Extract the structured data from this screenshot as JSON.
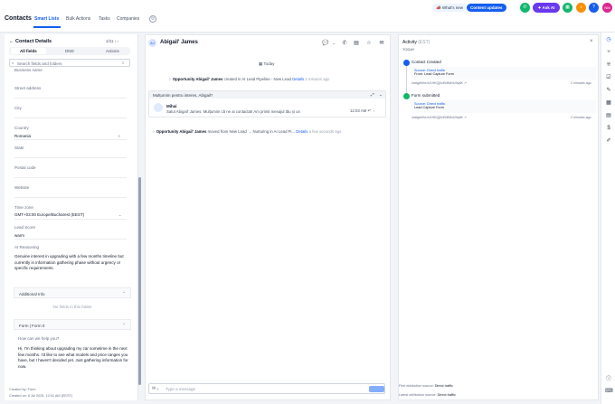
{
  "topbar": {
    "title": "Contacts",
    "tabs": [
      "Smart Lists",
      "Bulk Actions",
      "Tasks",
      "Companies"
    ],
    "whats_new": "What's new",
    "content_updates": "Content updates",
    "ask_ai": "Ask AI",
    "avatar": "NM",
    "help": "?"
  },
  "left": {
    "header": "Contact Details",
    "pager": "1/11",
    "tabs": [
      "All fields",
      "DND",
      "Actions"
    ],
    "search_placeholder": "Search fields and folders",
    "fields": [
      {
        "label": "Business name",
        "value": ""
      },
      {
        "label": "Street address",
        "value": ""
      },
      {
        "label": "City",
        "value": ""
      },
      {
        "label": "Country",
        "value": "Romania"
      },
      {
        "label": "State",
        "value": ""
      },
      {
        "label": "Postal code",
        "value": ""
      },
      {
        "label": "Website",
        "value": ""
      },
      {
        "label": "Time zone",
        "value": "GMT+03:00 Europe/Bucharest (EEST)"
      },
      {
        "label": "Lead Score",
        "value": "warm"
      },
      {
        "label": "AI Reasoning",
        "value": "Genuine interest in upgrading with a few months timeline but currently in information gathering phase without urgency or specific requirements."
      }
    ],
    "additional_info": "Additional Info",
    "no_fields": "No fields in this folder",
    "form_section": "Form | Form 0",
    "form_question": "How can we help you?",
    "form_answer": "Hi, I'm thinking about upgrading my car sometime in the next few months. I'd like to see what models and price ranges you have, but I haven't decided yet. Just gathering information for now.",
    "created_by": "Created by: Form",
    "created_at": "Created on: 6 Jul 2025, 12:01 AM (EEST)"
  },
  "center": {
    "avatar": "AJ",
    "name": "Abigail' James",
    "today": "Today",
    "event1_bold": "Opportunity Abigail' James",
    "event1_text": "created in AI Lead Pipeline - New Lead",
    "event1_link": "Details",
    "event1_time": "2 minutes ago",
    "chat_header": "Mulțumim pentru interes, Abigail'!",
    "chat_name": "Mihai",
    "chat_msg": "Salut Abigail' James. Mulțumim că ne ai contactat! Am primit mesajul tău și un",
    "chat_time": "12:03 AM",
    "event2_bold": "Opportunity Abigail' James",
    "event2_text": "moved from New Lead → Nurturing in AI Lead Pi...",
    "event2_link": "Details",
    "event2_time": "a few seconds ago",
    "composer_placeholder": "Type a message"
  },
  "right": {
    "title": "Activity",
    "title_tz": "(EST)",
    "today": "TODAY",
    "events": [
      {
        "title": "Contact Created",
        "source": "Source: Direct traffic",
        "detail": "From: Lead Capture Form",
        "url": "/widget/form/1HKQj0zEMlMvU9qdK",
        "time": "2 minutes ago",
        "color": "#155eef"
      },
      {
        "title": "Form submitted",
        "source": "Source: Direct traffic",
        "detail": "Lead Capture Form",
        "url": "/widget/form/1HKQj0zEMlMvU9qdK",
        "time": "2 minutes ago",
        "color": "#12b76a"
      }
    ],
    "first_attr": "First attribution source:",
    "first_attr_value": "Direct traffic",
    "last_attr": "Latest attribution source:",
    "last_attr_value": "Direct traffic"
  },
  "icons": {
    "phone": "phone-icon",
    "rail": [
      "clock-icon",
      "branch-icon",
      "grid-icon",
      "check-icon",
      "pencil-icon",
      "calendar-icon",
      "document-icon",
      "dollar-icon",
      "wrench-icon",
      "info-icon",
      "keyboard-icon"
    ]
  },
  "colors": {
    "primary": "#155eef",
    "green": "#12b76a",
    "orange": "#f79009",
    "purple": "#6938ef",
    "pink": "#dd2590"
  }
}
